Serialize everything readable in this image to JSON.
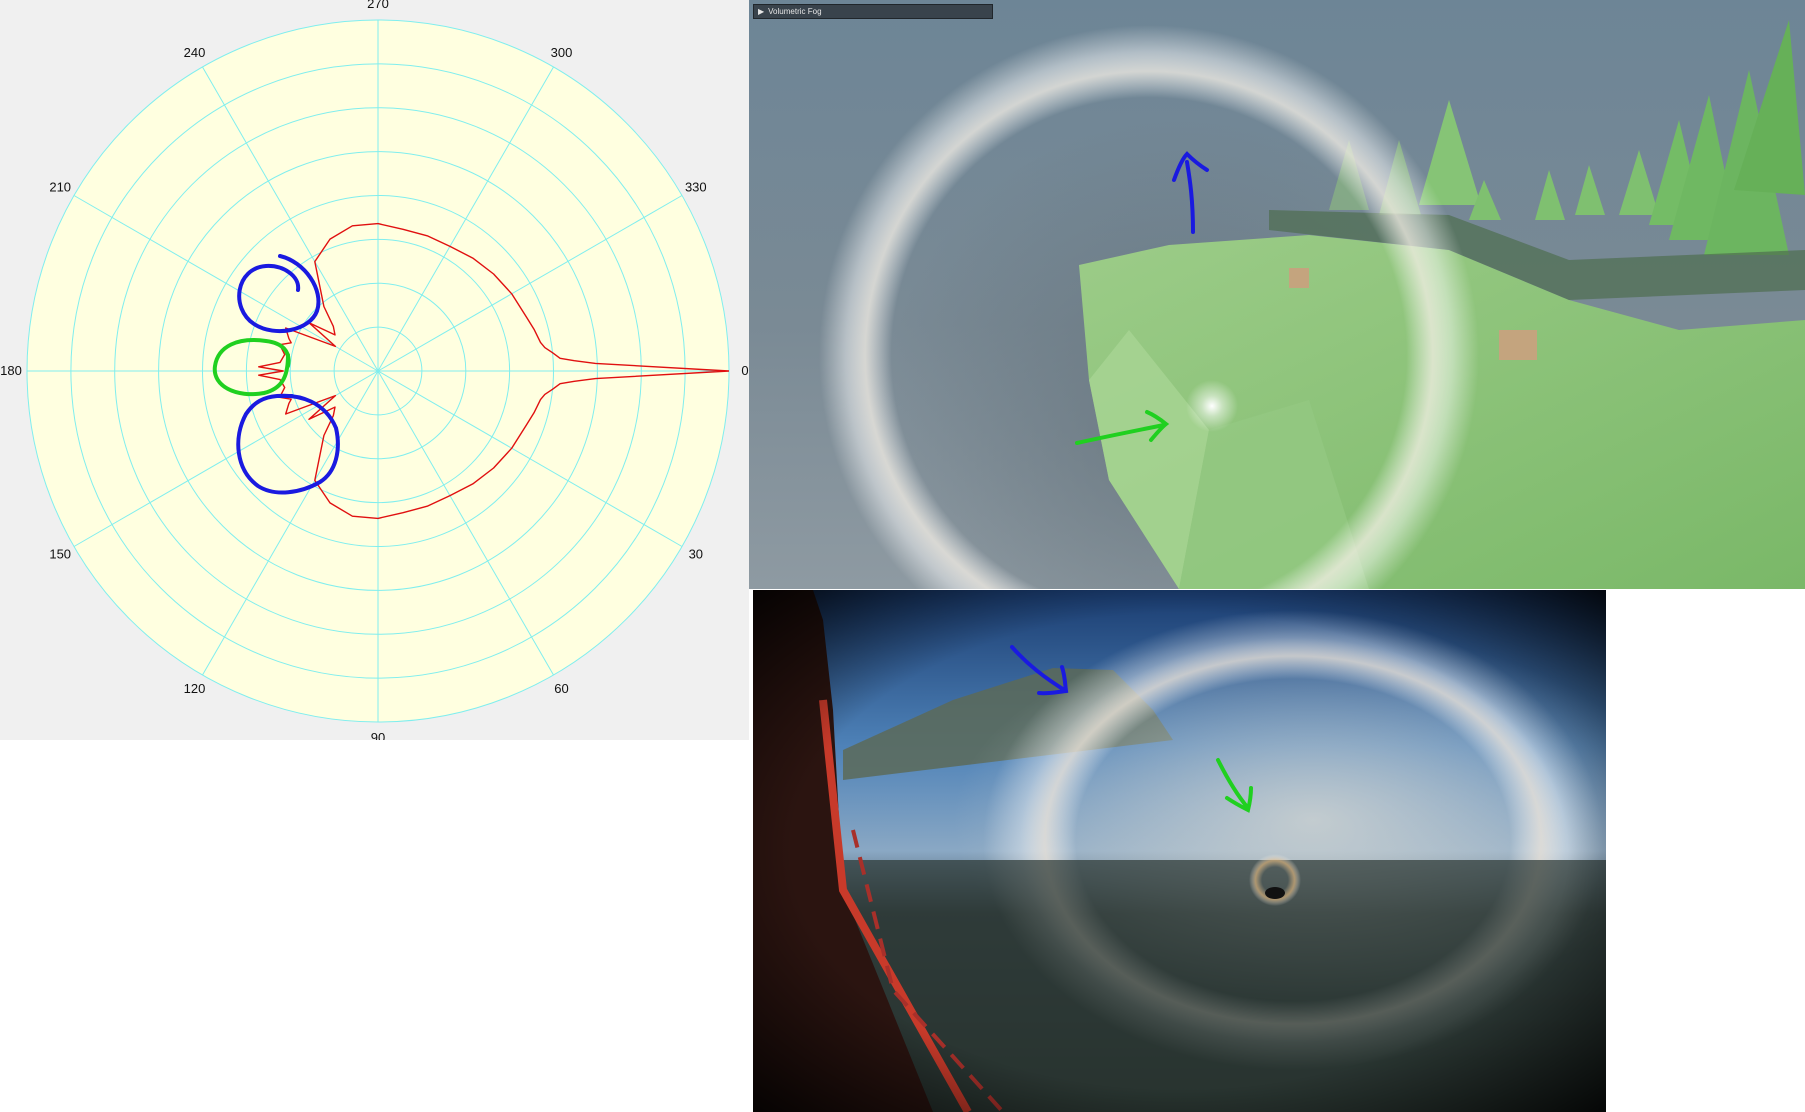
{
  "chart_data": {
    "type": "polar-line",
    "angle_direction": "clockwise",
    "zero_angle_position": "right",
    "angle_ticks": [
      0,
      30,
      60,
      90,
      120,
      150,
      180,
      210,
      240,
      270,
      300,
      330
    ],
    "angle_labels": [
      "0",
      "30",
      "60",
      "90",
      "120",
      "150",
      "180",
      "210",
      "240",
      "270",
      "300",
      "330"
    ],
    "radial_ring_count": 8,
    "grid": true,
    "series": [
      {
        "color": "#e01010",
        "note": "radius as fraction of outer ring",
        "theta_deg": [
          0,
          2,
          3,
          4,
          6,
          8,
          10,
          15,
          20,
          30,
          40,
          50,
          60,
          70,
          80,
          90,
          100,
          110,
          120,
          130,
          135,
          140,
          145,
          150,
          155,
          160,
          162,
          165,
          170,
          175,
          178,
          180
        ],
        "r": [
          1.0,
          0.62,
          0.56,
          0.52,
          0.5,
          0.48,
          0.47,
          0.46,
          0.45,
          0.44,
          0.43,
          0.42,
          0.41,
          0.41,
          0.41,
          0.42,
          0.42,
          0.4,
          0.36,
          0.24,
          0.18,
          0.16,
          0.24,
          0.14,
          0.29,
          0.27,
          0.26,
          0.29,
          0.27,
          0.28,
          0.34,
          0.27
        ]
      }
    ],
    "annotations": [
      {
        "shape": "loop",
        "color": "#1a1ae0",
        "near_angle_deg": 205
      },
      {
        "shape": "loop",
        "color": "#20d020",
        "near_angle_deg": 180
      },
      {
        "shape": "loop",
        "color": "#1a1ae0",
        "near_angle_deg": 155
      }
    ]
  },
  "render_panel": {
    "header_arrow": "▶",
    "header_label": "Volumetric Fog"
  },
  "colors": {
    "plot_background": "#ffffe0",
    "grid": "#80eeee",
    "series": "#e01010",
    "annotation_blue": "#1a1ae0",
    "annotation_green": "#20d020",
    "sky": "#6f8594",
    "terrain": "#8cc878",
    "tree": "#7cd070"
  }
}
